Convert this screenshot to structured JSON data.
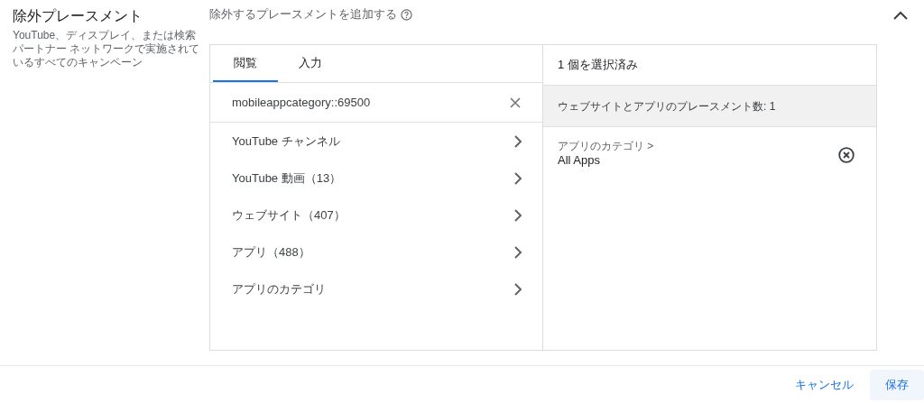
{
  "section": {
    "title": "除外プレースメント",
    "description": "YouTube、ディスプレイ、または検索パートナー ネットワークで実施されているすべてのキャンペーン",
    "expanded": true
  },
  "heading": "除外するプレースメントを追加する",
  "tabs": [
    {
      "label": "閲覧",
      "selected": true
    },
    {
      "label": "入力",
      "selected": false
    }
  ],
  "search": {
    "value": "mobileappcategory::69500"
  },
  "categories": [
    "YouTube チャンネル",
    "YouTube 動画（13）",
    "ウェブサイト（407）",
    "アプリ（488）",
    "アプリのカテゴリ"
  ],
  "selected_panel": {
    "header": "1 個を選択済み",
    "group": "ウェブサイトとアプリのプレースメント数: 1",
    "items": [
      {
        "path": "アプリのカテゴリ >",
        "name": "All Apps"
      }
    ]
  },
  "buttons": {
    "cancel": "キャンセル",
    "save": "保存"
  }
}
